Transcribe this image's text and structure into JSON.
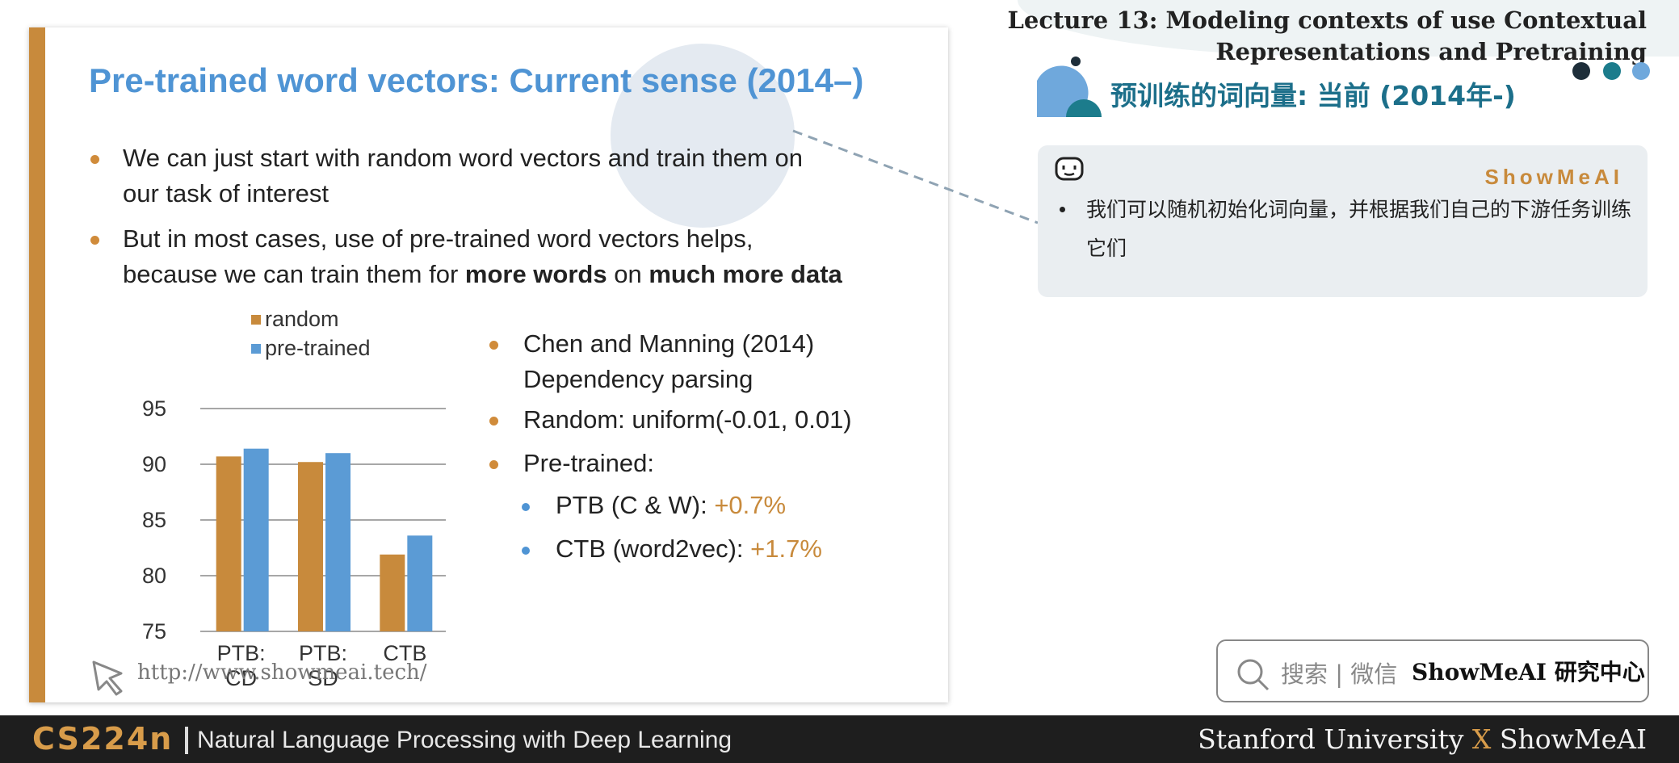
{
  "header": {
    "lecture_line1": "Lecture 13:  Modeling contexts of use Contextual",
    "lecture_line2": "Representations and Pretraining"
  },
  "slide": {
    "title": "Pre-trained word vectors: Current sense (2014–)",
    "bullet1_line1": "We can just start with random word vectors and train them on",
    "bullet1_line2": "our task of interest",
    "bullet2_line1": "But in most cases, use of pre-trained word vectors helps,",
    "bullet2_line2_a": "because we can train them for ",
    "bullet2_line2_b": "more words",
    "bullet2_line2_c": " on ",
    "bullet2_line2_d": "much more data",
    "right_b1_line1": "Chen and Manning (2014)",
    "right_b1_line2": "Dependency parsing",
    "right_b2": "Random:  uniform(-0.01, 0.01)",
    "right_b3": "Pre-trained:",
    "sub1_label": "PTB (C & W):   ",
    "sub1_value": "+0.7%",
    "sub2_label": "CTB (word2vec): ",
    "sub2_value": "+1.7%",
    "url": "http://www.showmeai.tech/"
  },
  "chart_data": {
    "type": "bar",
    "categories": [
      [
        "PTB:",
        "CD"
      ],
      [
        "PTB:",
        "SD"
      ],
      [
        "CTB"
      ]
    ],
    "series": [
      {
        "name": "random",
        "values": [
          90.7,
          90.2,
          81.9
        ],
        "color": "#c88a3c"
      },
      {
        "name": "pre-trained",
        "values": [
          91.4,
          91.0,
          83.6
        ],
        "color": "#5b9bd5"
      }
    ],
    "yticks": [
      95,
      90,
      85,
      80,
      75
    ],
    "ylim": [
      75,
      95
    ],
    "grid": true,
    "legend": "top-left"
  },
  "right_panel": {
    "heading": "预训练的词向量: 当前 (2014年-)",
    "brand": "ShowMeAI",
    "note_text": "我们可以随机初始化词向量，并根据我们自己的下游任务训练它们",
    "search_label": "搜索 | 微信",
    "search_brand": "ShowMeAI 研究中心"
  },
  "footer": {
    "course": "CS224n",
    "subtitle": "Natural Language Processing with Deep Learning",
    "right_a": "Stanford University ",
    "right_x": "X",
    "right_b": " ShowMeAI"
  },
  "colors": {
    "accent_orange": "#c88a3c",
    "accent_blue": "#4f94d4",
    "teal": "#1c6f8a"
  }
}
